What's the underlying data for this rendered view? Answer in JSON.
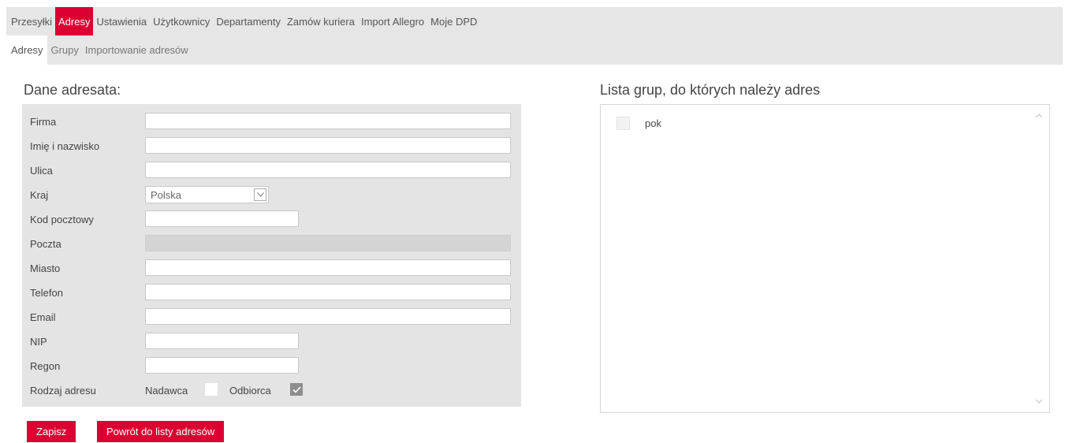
{
  "nav": {
    "tabs": [
      "Przesyłki",
      "Adresy",
      "Ustawienia",
      "Użytkownicy",
      "Departamenty",
      "Zamów kuriera",
      "Import Allegro",
      "Moje DPD"
    ],
    "active": 1
  },
  "subnav": {
    "tabs": [
      "Adresy",
      "Grupy",
      "Importowanie adresów"
    ],
    "active": 0
  },
  "form": {
    "title": "Dane adresata:",
    "fields": {
      "firma": {
        "label": "Firma",
        "value": ""
      },
      "imie": {
        "label": "Imię i nazwisko",
        "value": ""
      },
      "ulica": {
        "label": "Ulica",
        "value": ""
      },
      "kraj": {
        "label": "Kraj",
        "value": "Polska"
      },
      "kod": {
        "label": "Kod pocztowy",
        "value": ""
      },
      "poczta": {
        "label": "Poczta",
        "value": ""
      },
      "miasto": {
        "label": "Miasto",
        "value": ""
      },
      "telefon": {
        "label": "Telefon",
        "value": ""
      },
      "email": {
        "label": "Email",
        "value": ""
      },
      "nip": {
        "label": "NIP",
        "value": ""
      },
      "regon": {
        "label": "Regon",
        "value": ""
      }
    },
    "rodzaj": {
      "label": "Rodzaj adresu",
      "nadawca": {
        "label": "Nadawca",
        "checked": false
      },
      "odbiorca": {
        "label": "Odbiorca",
        "checked": true
      }
    },
    "buttons": {
      "save": "Zapisz",
      "back": "Powrót do listy adresów"
    }
  },
  "groups": {
    "title": "Lista grup, do których należy adres",
    "items": [
      {
        "label": "pok",
        "checked": false
      }
    ]
  },
  "colors": {
    "accent": "#dc0032",
    "nav_bg": "#e6e6e6",
    "panel_bg": "#e4e4e4"
  }
}
